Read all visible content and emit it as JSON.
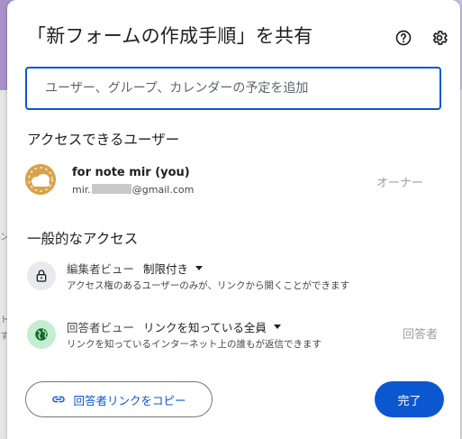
{
  "dialog": {
    "title": "「新フォームの作成手順」を共有",
    "help_icon": "help-circle-icon",
    "settings_icon": "gear-icon"
  },
  "search": {
    "placeholder": "ユーザー、グループ、カレンダーの予定を追加",
    "value": ""
  },
  "people_section": {
    "title": "アクセスできるユーザー",
    "users": [
      {
        "name": "for note mir (you)",
        "email_prefix": "mir.",
        "email_suffix": "@gmail.com",
        "role": "オーナー",
        "avatar_icon": "cloud-avatar-icon"
      }
    ]
  },
  "general_access": {
    "title": "一般的なアクセス",
    "rows": [
      {
        "icon": "lock-icon",
        "role_prefix": "編集者ビュー",
        "selected": "制限付き",
        "description": "アクセス権のあるユーザーのみが、リンクから開くことができます",
        "role": ""
      },
      {
        "icon": "globe-icon",
        "role_prefix": "回答者ビュー",
        "selected": "リンクを知っている全員",
        "description": "リンクを知っているインターネット上の誰もが返信できます",
        "role": "回答者"
      }
    ]
  },
  "footer": {
    "copy_link_label": "回答者リンクをコピー",
    "copy_link_icon": "link-icon",
    "done_label": "完了"
  },
  "colors": {
    "accent": "#0b57d0",
    "lock_bg": "#e8eaed",
    "globe_bg": "#c4eed0",
    "globe_fg": "#146c2e",
    "avatar_bg": "#d8a14a"
  }
}
